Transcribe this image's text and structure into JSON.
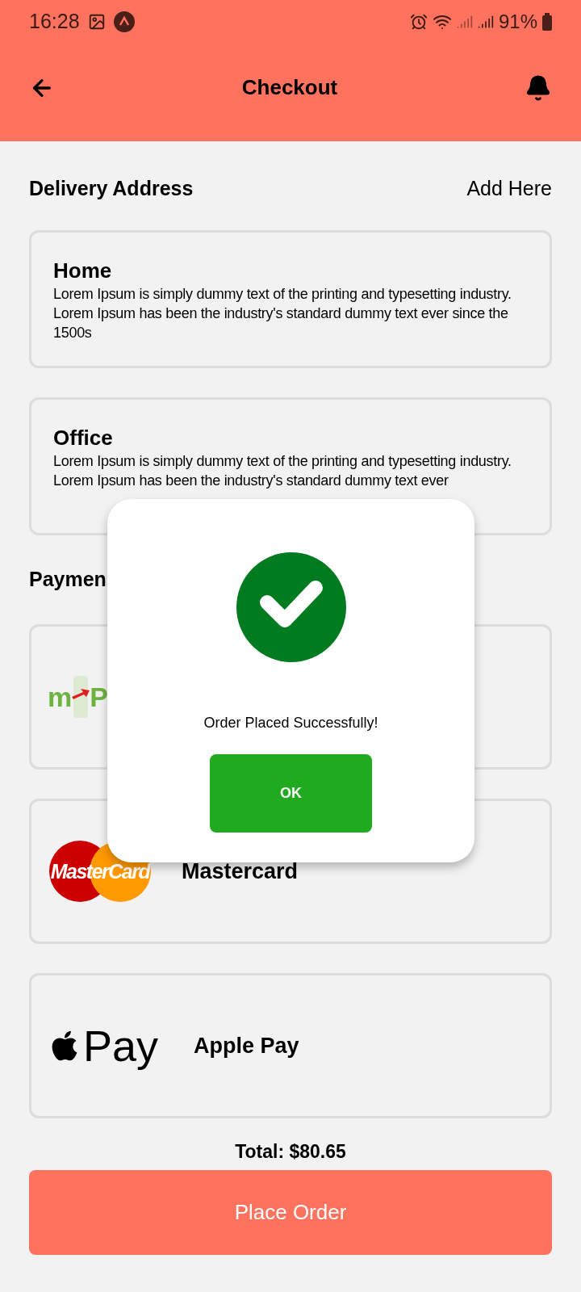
{
  "status_bar": {
    "time": "16:28",
    "battery": "91%"
  },
  "header": {
    "title": "Checkout"
  },
  "delivery": {
    "title": "Delivery Address",
    "action": "Add Here",
    "addresses": [
      {
        "name": "Home",
        "text": "Lorem Ipsum is simply dummy text of the printing and typesetting industry. Lorem Ipsum has been the industry's standard dummy text ever since the 1500s"
      },
      {
        "name": "Office",
        "text": "Lorem Ipsum is simply dummy text of the printing and typesetting industry. Lorem Ipsum has been the industry's standard dummy text ever"
      }
    ]
  },
  "payment": {
    "title": "Paymen",
    "methods": [
      {
        "kind": "mpesa",
        "logo_text": [
          "m",
          "P"
        ]
      },
      {
        "kind": "mastercard",
        "logo_text": "MasterCard",
        "label": "Mastercard"
      },
      {
        "kind": "applepay",
        "logo_text": "Pay",
        "label": "Apple Pay"
      }
    ]
  },
  "total": "Total: $80.65",
  "place_order": "Place Order",
  "dialog": {
    "message": "Order Placed Successfully!",
    "button": "OK"
  }
}
